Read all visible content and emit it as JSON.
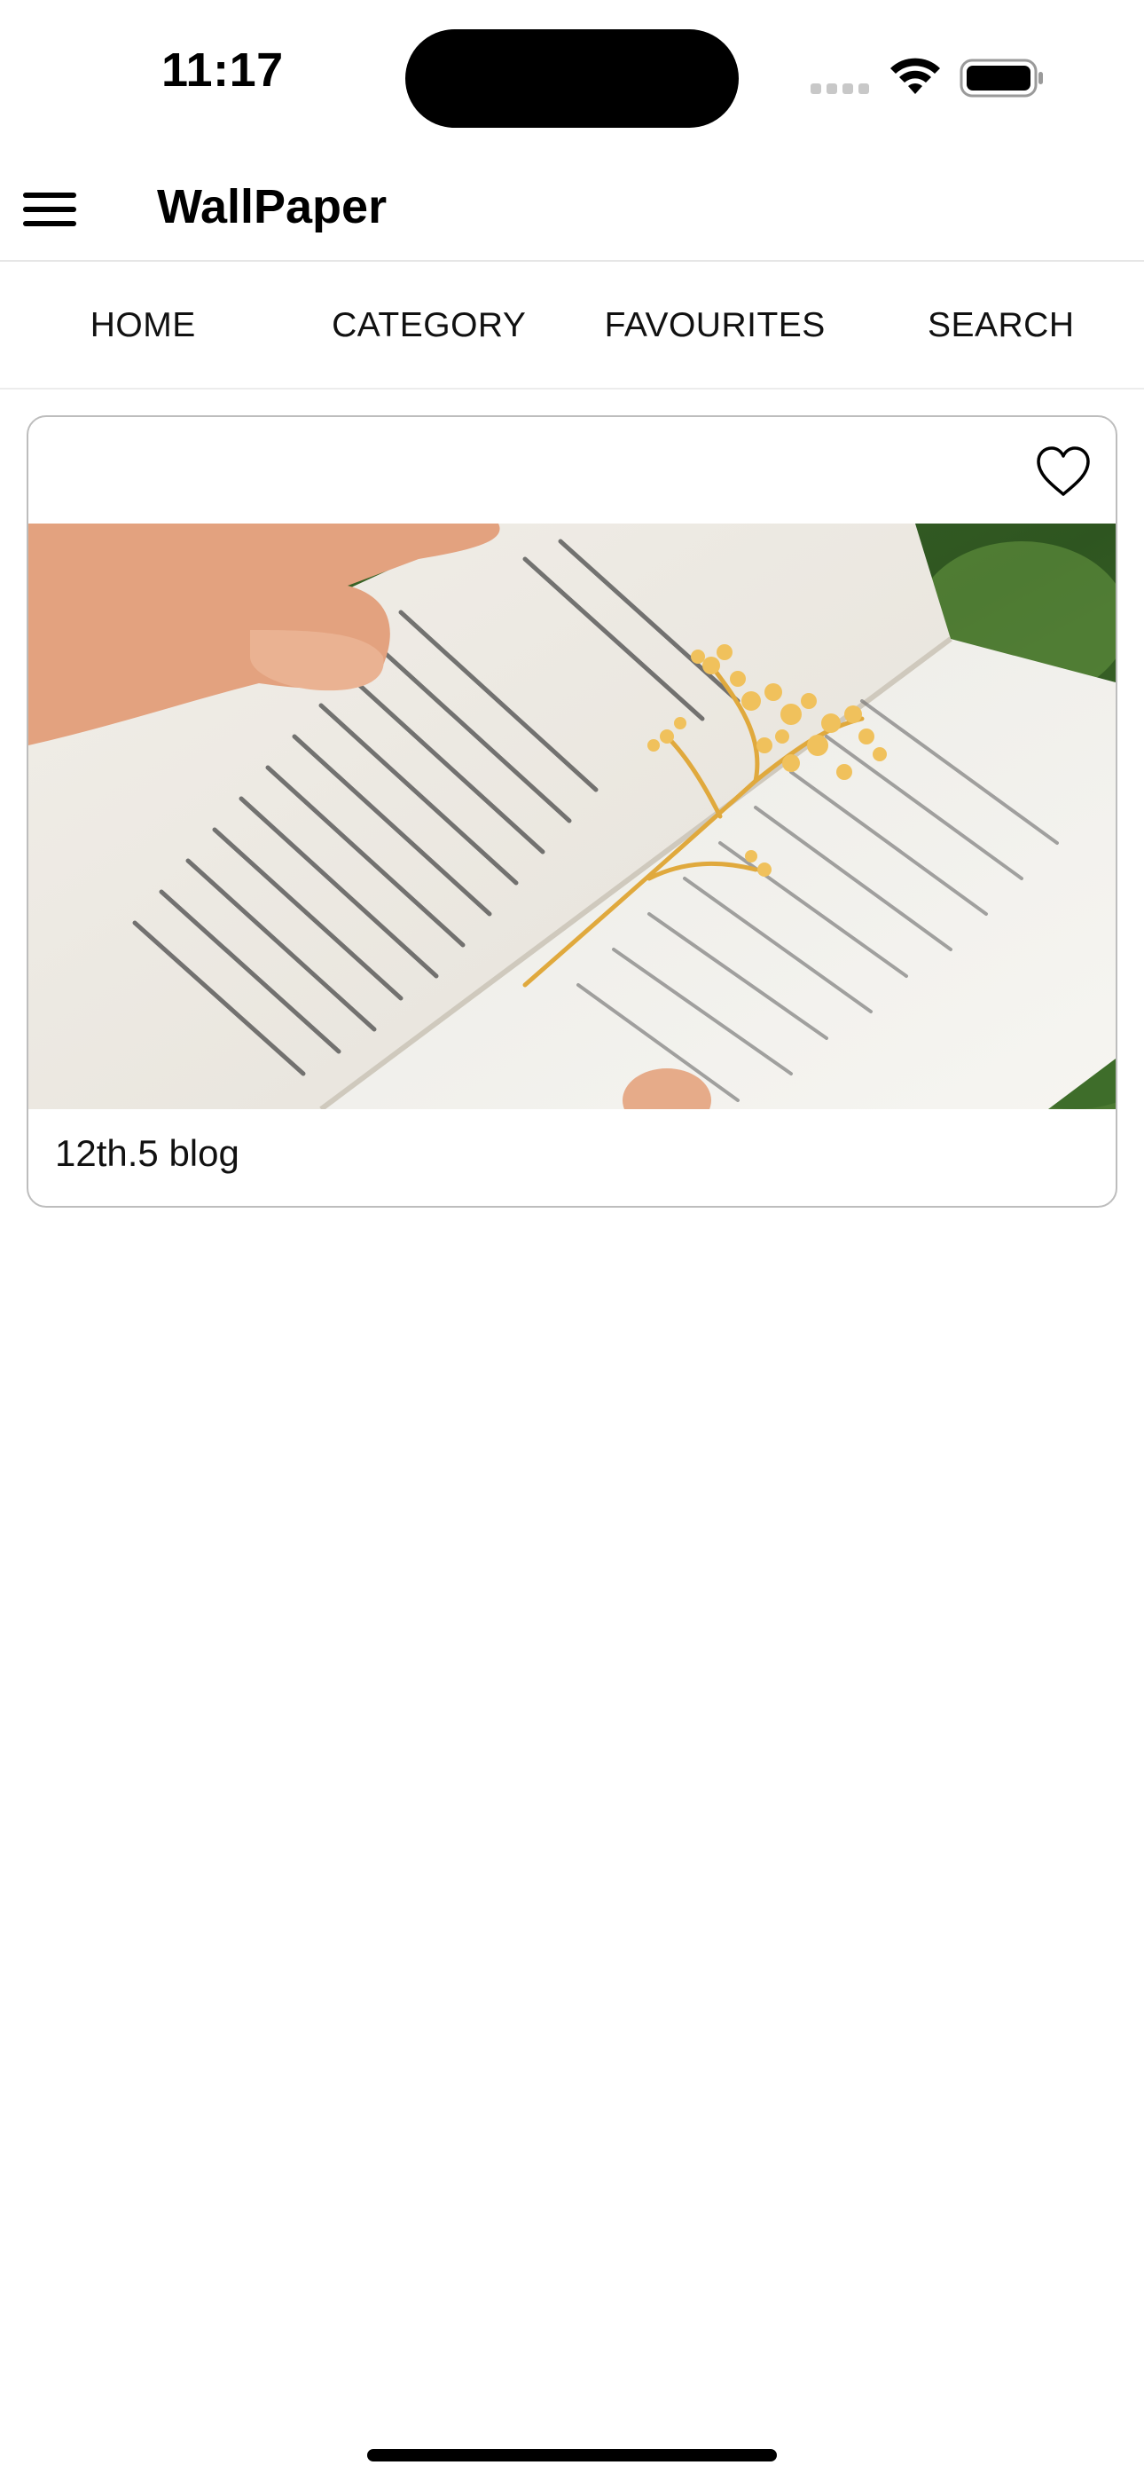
{
  "status_bar": {
    "time": "11:17"
  },
  "app_bar": {
    "title": "WallPaper",
    "menu_icon": "hamburger-menu-icon"
  },
  "tabs": [
    {
      "label": "HOME"
    },
    {
      "label": "CATEGORY"
    },
    {
      "label": "FAVOURITES"
    },
    {
      "label": "SEARCH"
    }
  ],
  "cards": [
    {
      "caption": "12th.5 blog",
      "favourite_icon": "heart-outline-icon",
      "image_alt": "Open book with a dried yellow flower sprig"
    }
  ],
  "colors": {
    "background": "#ffffff",
    "text": "#111111",
    "divider": "#e6e6e6",
    "card_border": "#bdbdbd",
    "flower": "#e9b64f"
  }
}
